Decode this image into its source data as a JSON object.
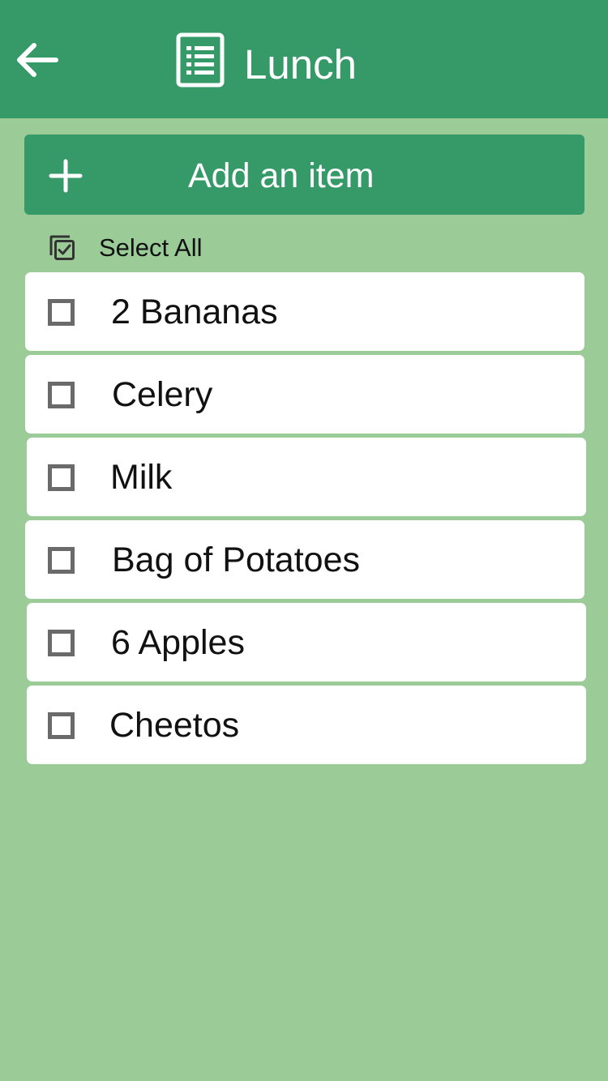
{
  "header": {
    "title": "Lunch",
    "back_icon": "arrow-left-icon",
    "list_icon": "list-document-icon",
    "background": "#359a68"
  },
  "add_item": {
    "label": "Add an item",
    "icon": "plus-icon"
  },
  "select_all": {
    "label": "Select All",
    "icon": "select-all-checkbox-icon"
  },
  "items": [
    {
      "label": "2 Bananas",
      "checked": false
    },
    {
      "label": "Celery",
      "checked": false
    },
    {
      "label": "Milk",
      "checked": false
    },
    {
      "label": "Bag of Potatoes",
      "checked": false
    },
    {
      "label": "6 Apples",
      "checked": false
    },
    {
      "label": "Cheetos",
      "checked": false
    }
  ],
  "colors": {
    "page_background": "#9bcc98",
    "accent": "#359a68",
    "card": "#ffffff",
    "checkbox_border": "#6a6a6a"
  }
}
